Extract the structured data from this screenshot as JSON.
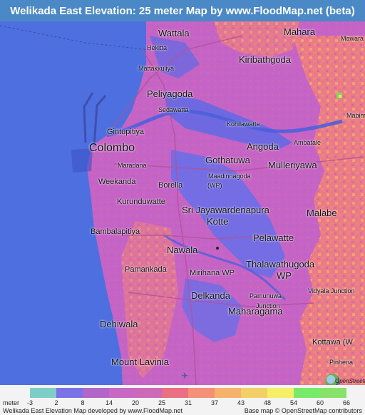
{
  "title": "Welikada East Elevation: 25 meter Map by www.FloodMap.net (beta)",
  "colors": {
    "title_bar": "#4a88c6",
    "sea": "#4d6fe0",
    "low_land": "#6a73e6",
    "mid_land": "#c063c4",
    "high_land": "#e86f8e",
    "higher_land": "#f3a266"
  },
  "map": {
    "places": [
      {
        "name": "Wattala",
        "size": "med"
      },
      {
        "name": "Mahara",
        "size": "med"
      },
      {
        "name": "Mawara",
        "size": "tiny"
      },
      {
        "name": "Hekitta",
        "size": "tiny"
      },
      {
        "name": "Kiribathgoda",
        "size": "med"
      },
      {
        "name": "Mattakkuliya",
        "size": "tiny"
      },
      {
        "name": "Peliyagoda",
        "size": "med"
      },
      {
        "name": "Sedawatta",
        "size": "tiny"
      },
      {
        "name": "Mabim",
        "size": "tiny"
      },
      {
        "name": "Kohilawatte",
        "size": "tiny"
      },
      {
        "name": "Gintupitiya",
        "size": "small"
      },
      {
        "name": "Ambatale",
        "size": "tiny"
      },
      {
        "name": "Colombo",
        "size": "xl"
      },
      {
        "name": "Angoda",
        "size": "med"
      },
      {
        "name": "Gothatuwa",
        "size": "med"
      },
      {
        "name": "Maradana",
        "size": "tiny"
      },
      {
        "name": "Mulleriyawa",
        "size": "med"
      },
      {
        "name": "Maadinnagoda",
        "size": "tiny"
      },
      {
        "name": "(WP)",
        "size": "tiny"
      },
      {
        "name": "Weekanda",
        "size": "small"
      },
      {
        "name": "Borella",
        "size": "small"
      },
      {
        "name": "Kurunduwatte",
        "size": "small"
      },
      {
        "name": "Sri Jayawardenapura",
        "size": "med"
      },
      {
        "name": "Kotte",
        "size": "med"
      },
      {
        "name": "Malabe",
        "size": "med"
      },
      {
        "name": "Bambalapitiya",
        "size": "small"
      },
      {
        "name": "Pelawatte",
        "size": "med"
      },
      {
        "name": "Nawala",
        "size": "med"
      },
      {
        "name": "Thalawathugoda",
        "size": "med"
      },
      {
        "name": "WP",
        "size": "med"
      },
      {
        "name": "Pamankada",
        "size": "small"
      },
      {
        "name": "Mirihana WP",
        "size": "small"
      },
      {
        "name": "Delkanda",
        "size": "med"
      },
      {
        "name": "Vidyala Junction",
        "size": "tiny"
      },
      {
        "name": "Pamunuwa",
        "size": "tiny"
      },
      {
        "name": "Junction",
        "size": "tiny"
      },
      {
        "name": "Dehiwala",
        "size": "med"
      },
      {
        "name": "Maharagama",
        "size": "med"
      },
      {
        "name": "Kottawa (W",
        "size": "small"
      },
      {
        "name": "Mount Lavinia",
        "size": "med"
      },
      {
        "name": "Pinhena",
        "size": "tiny"
      }
    ],
    "osm_logo_text": "OpenStreetMap"
  },
  "legend": {
    "unit_label": "meter",
    "ticks": [
      "-3",
      "2",
      "8",
      "14",
      "20",
      "25",
      "31",
      "37",
      "43",
      "48",
      "54",
      "60",
      "66"
    ],
    "colors": [
      "#7ecdc6",
      "#7b72e8",
      "#b166c8",
      "#c868c4",
      "#cc6ab8",
      "#ea6f82",
      "#f48f78",
      "#f6b26c",
      "#f2d068",
      "#f4ef66",
      "#78ea6a",
      "#86e26a"
    ],
    "credit_left": "Welikada East Elevation Map developed by www.FloodMap.net",
    "credit_right": "Base map © OpenStreetMap contributors"
  }
}
